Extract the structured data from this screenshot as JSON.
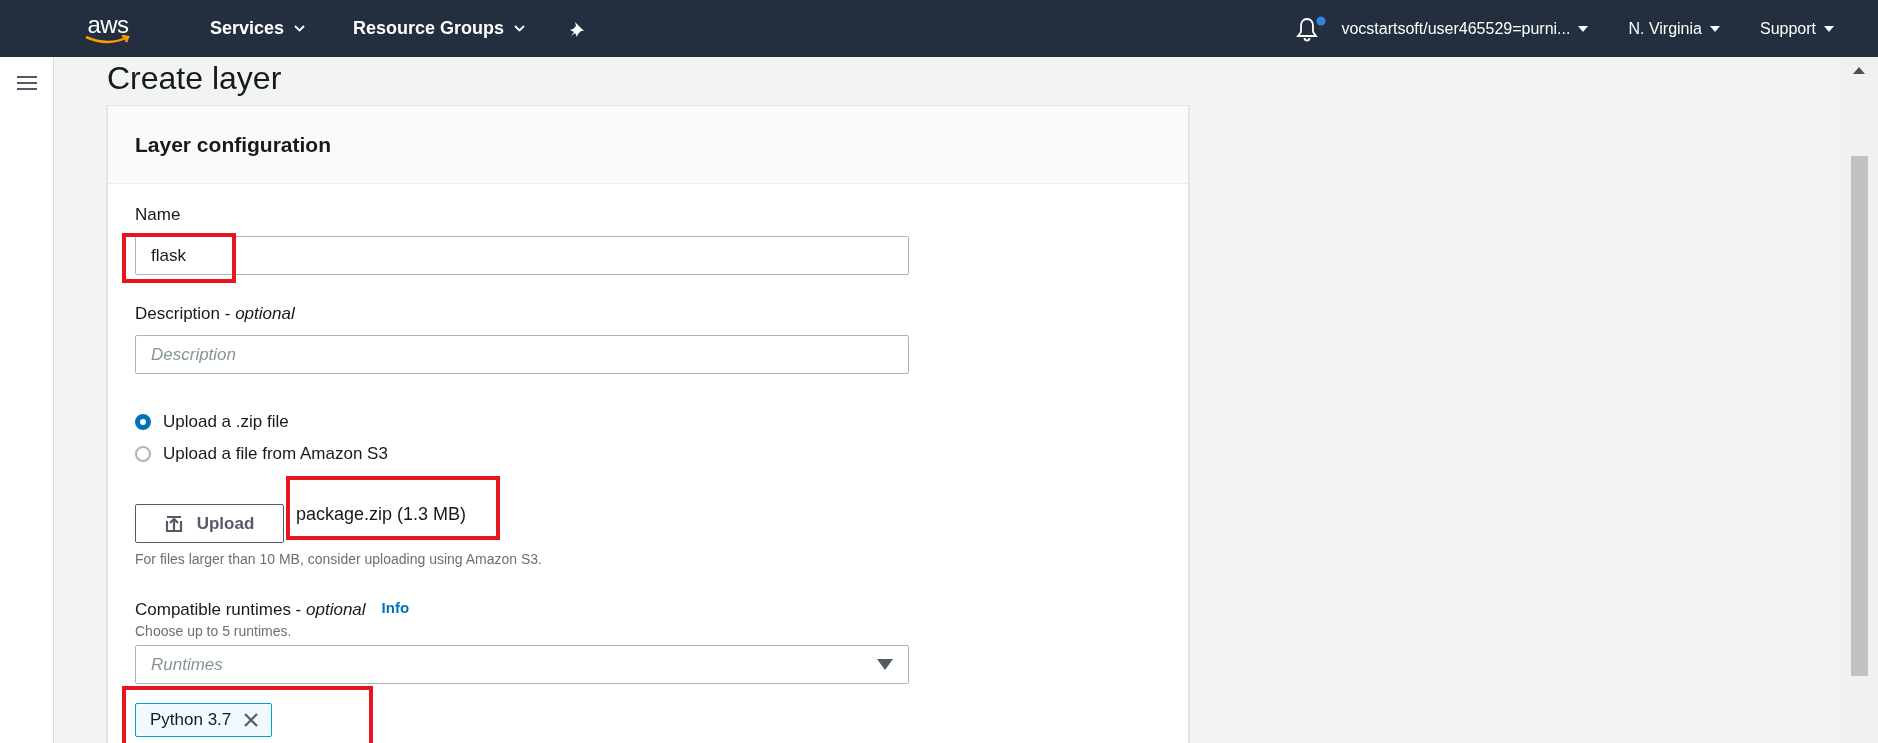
{
  "top_nav": {
    "logo": "aws",
    "menus": [
      {
        "label": "Services"
      },
      {
        "label": "Resource Groups"
      }
    ],
    "notifications": {
      "unread": true
    },
    "account": "vocstartsoft/user465529=purni...",
    "region": "N. Virginia",
    "support": "Support"
  },
  "page_title": "Create layer",
  "card": {
    "title": "Layer configuration",
    "name_field": {
      "label": "Name",
      "value": "flask",
      "highlighted": true
    },
    "description_field": {
      "label": "Description - *optional*",
      "placeholder": "Description"
    },
    "upload_options": [
      {
        "label": "Upload a .zip file",
        "selected": true
      },
      {
        "label": "Upload a file from Amazon S3",
        "selected": false
      }
    ],
    "upload_button": "Upload",
    "file_name": {
      "text": "package.zip (1.3 MB)",
      "highlighted": true
    },
    "upload_hint": "For files larger than 10 MB, consider uploading using Amazon S3.",
    "runtimes": {
      "label": "Compatible runtimes - *optional*",
      "info_link": "Info",
      "hint": "Choose up to 5 runtimes.",
      "placeholder": "Runtimes",
      "tokens": [
        {
          "label": "Python 3.7",
          "highlighted": true
        }
      ]
    }
  }
}
